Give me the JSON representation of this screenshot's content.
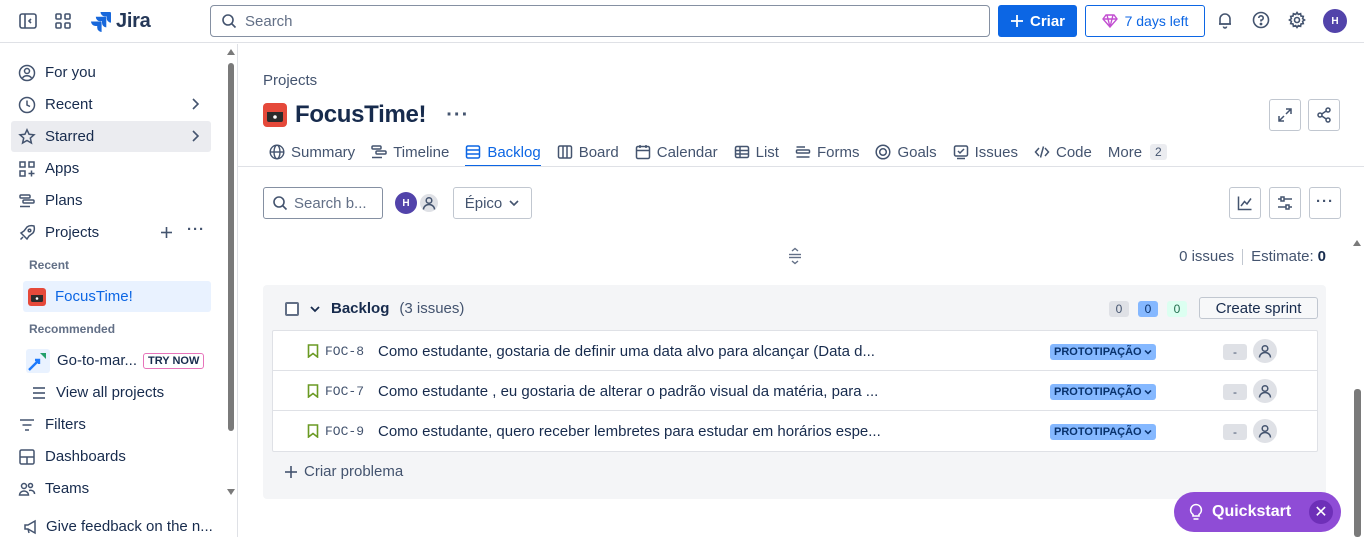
{
  "app": {
    "brand": "Jira",
    "search_placeholder": "Search",
    "create_label": "Criar",
    "trial_label": "7 days left",
    "avatar_initial": "H"
  },
  "sidebar": {
    "items": [
      {
        "label": "For you",
        "icon": "user-circle-icon"
      },
      {
        "label": "Recent",
        "icon": "clock-icon"
      },
      {
        "label": "Starred",
        "icon": "star-icon"
      },
      {
        "label": "Apps",
        "icon": "apps-icon"
      },
      {
        "label": "Plans",
        "icon": "plans-icon"
      },
      {
        "label": "Projects",
        "icon": "rocket-icon"
      }
    ],
    "recent_heading": "Recent",
    "recent_project": "FocusTime!",
    "recommended_heading": "Recommended",
    "recommended_item": "Go-to-mar...",
    "try_now": "TRY NOW",
    "view_all": "View all projects",
    "bottom_items": [
      {
        "label": "Filters",
        "icon": "filter-icon"
      },
      {
        "label": "Dashboards",
        "icon": "dashboard-icon"
      },
      {
        "label": "Teams",
        "icon": "teams-icon"
      }
    ],
    "feedback": "Give feedback on the n..."
  },
  "page": {
    "breadcrumb": "Projects",
    "project_title": "FocusTime!",
    "tabs": [
      {
        "label": "Summary",
        "icon": "globe-icon"
      },
      {
        "label": "Timeline",
        "icon": "timeline-icon"
      },
      {
        "label": "Backlog",
        "icon": "backlog-icon",
        "active": true
      },
      {
        "label": "Board",
        "icon": "board-icon"
      },
      {
        "label": "Calendar",
        "icon": "calendar-icon"
      },
      {
        "label": "List",
        "icon": "list-icon"
      },
      {
        "label": "Forms",
        "icon": "forms-icon"
      },
      {
        "label": "Goals",
        "icon": "goals-icon"
      },
      {
        "label": "Issues",
        "icon": "issues-icon"
      },
      {
        "label": "Code",
        "icon": "code-icon"
      }
    ],
    "more_label": "More",
    "more_count": "2"
  },
  "toolbar": {
    "search_placeholder": "Search b...",
    "avatar_initial": "H",
    "epic_label": "Épico"
  },
  "stats": {
    "issues": "0 issues",
    "estimate_label": "Estimate:",
    "estimate_value": "0"
  },
  "backlog": {
    "title": "Backlog",
    "count": "(3 issues)",
    "pills": [
      "0",
      "0",
      "0"
    ],
    "create_sprint": "Create sprint",
    "issues": [
      {
        "key": "FOC-8",
        "summary": "Como estudante, gostaria de definir uma data alvo para alcançar (Data d...",
        "epic": "PROTOTIPAÇÃO",
        "estimate": "-"
      },
      {
        "key": "FOC-7",
        "summary": "Como estudante , eu gostaria de alterar o padrão visual da matéria, para ...",
        "epic": "PROTOTIPAÇÃO",
        "estimate": "-"
      },
      {
        "key": "FOC-9",
        "summary": "Como estudante, quero receber lembretes para estudar em horários espe...",
        "epic": "PROTOTIPAÇÃO",
        "estimate": "-"
      }
    ],
    "create_issue": "Criar problema"
  },
  "quickstart": {
    "label": "Quickstart"
  },
  "colors": {
    "accent": "#0c66e4",
    "project_icon": "#e5493a",
    "epic_bg": "#85b8ff",
    "quickstart": "#8f4cd6",
    "story_green": "#6a9a23"
  }
}
